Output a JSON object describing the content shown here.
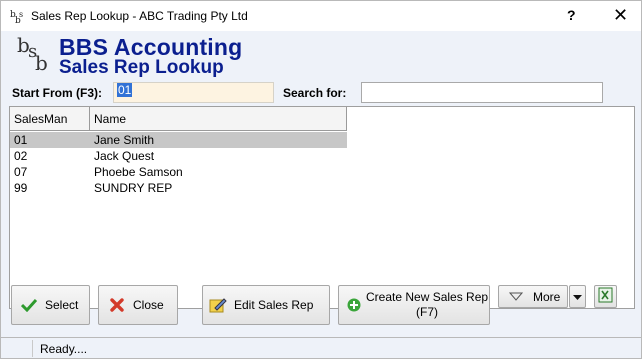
{
  "window": {
    "title": "Sales Rep Lookup - ABC Trading Pty Ltd",
    "help_glyph": "?",
    "close_glyph": "✕"
  },
  "header": {
    "brand_line1": "BBS Accounting",
    "brand_line2": "Sales Rep Lookup"
  },
  "filters": {
    "start_label": "Start From (F3):",
    "start_value": "01",
    "search_label": "Search for:",
    "search_value": ""
  },
  "table": {
    "columns": [
      "SalesMan",
      "Name"
    ],
    "rows": [
      {
        "code": "01",
        "name": "Jane Smith",
        "selected": true
      },
      {
        "code": "02",
        "name": "Jack Quest",
        "selected": false
      },
      {
        "code": "07",
        "name": "Phoebe Samson",
        "selected": false
      },
      {
        "code": "99",
        "name": "SUNDRY REP",
        "selected": false
      }
    ]
  },
  "buttons": {
    "select": "Select",
    "close": "Close",
    "edit": "Edit Sales Rep",
    "create_line1": "Create New Sales Rep",
    "create_line2": "(F7)",
    "more": "More"
  },
  "status": {
    "text": "Ready...."
  },
  "colors": {
    "brand": "#0b1f8f",
    "client_bg": "#eef2f9",
    "selected_row": "#c7c7c7",
    "start_input_bg": "#fdf3e1"
  },
  "icons": [
    "bbs-logo-icon",
    "checkmark-icon",
    "close-x-icon",
    "edit-pencil-icon",
    "add-plus-icon",
    "chevron-down-icon",
    "excel-export-icon"
  ]
}
